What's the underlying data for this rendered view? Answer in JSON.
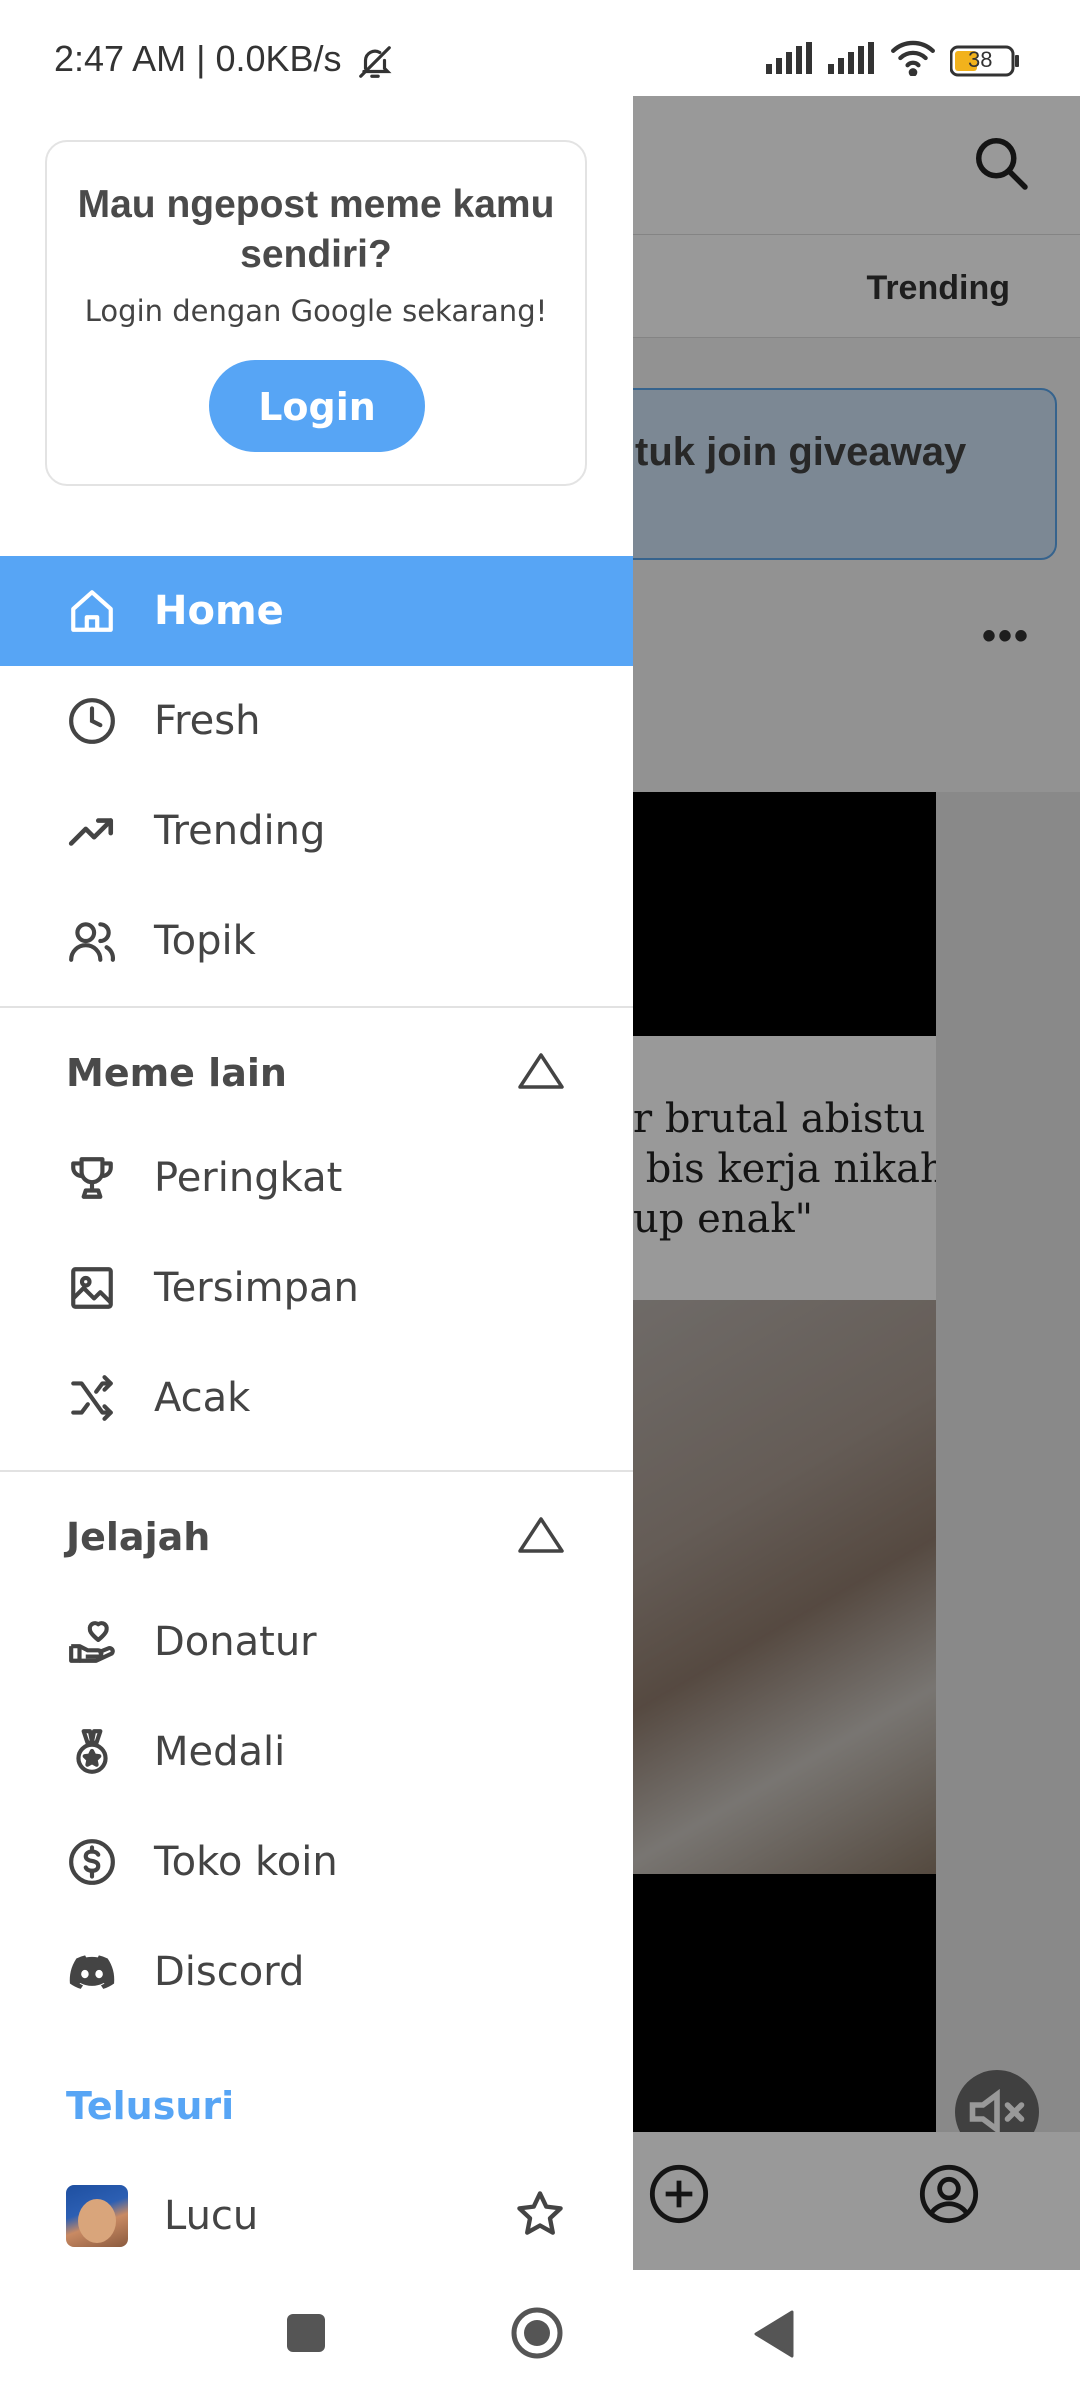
{
  "status_bar": {
    "time": "2:47 AM | 0.0KB/s",
    "battery": "38",
    "icons": [
      "bell-off-icon",
      "signal-icon",
      "signal-icon",
      "wifi-icon",
      "battery-icon"
    ]
  },
  "background_app": {
    "tab_trending": "Trending",
    "banner_text": "tuk join giveaway",
    "more": "•••",
    "caption": "r brutal abistu\n bis kerja nikah\nup enak\"",
    "icons": [
      "search-icon",
      "more-icon",
      "mute-icon",
      "add-icon",
      "account-icon"
    ]
  },
  "drawer": {
    "login_card": {
      "title": "Mau ngepost meme kamu sendiri?",
      "subtitle": "Login dengan Google sekarang!",
      "button": "Login"
    },
    "main_menu": [
      {
        "label": "Home",
        "icon": "home-icon",
        "active": true
      },
      {
        "label": "Fresh",
        "icon": "clock-icon",
        "active": false
      },
      {
        "label": "Trending",
        "icon": "trending-up-icon",
        "active": false
      },
      {
        "label": "Topik",
        "icon": "users-icon",
        "active": false
      }
    ],
    "section_meme_lain": {
      "title": "Meme lain",
      "items": [
        {
          "label": "Peringkat",
          "icon": "trophy-icon"
        },
        {
          "label": "Tersimpan",
          "icon": "image-icon"
        },
        {
          "label": "Acak",
          "icon": "shuffle-icon"
        }
      ]
    },
    "section_jelajah": {
      "title": "Jelajah",
      "items": [
        {
          "label": "Donatur",
          "icon": "hand-heart-icon"
        },
        {
          "label": "Medali",
          "icon": "medal-icon"
        },
        {
          "label": "Toko koin",
          "icon": "dollar-coin-icon"
        },
        {
          "label": "Discord",
          "icon": "discord-icon"
        }
      ]
    },
    "telusuri": {
      "title": "Telusuri",
      "items": [
        {
          "label": "Lucu",
          "icon": "star-icon"
        }
      ]
    }
  },
  "nav_bar": {
    "icons": [
      "recents-square-icon",
      "home-circle-icon",
      "back-triangle-icon"
    ]
  },
  "colors": {
    "accent": "#57a5f5",
    "text": "#444444"
  }
}
